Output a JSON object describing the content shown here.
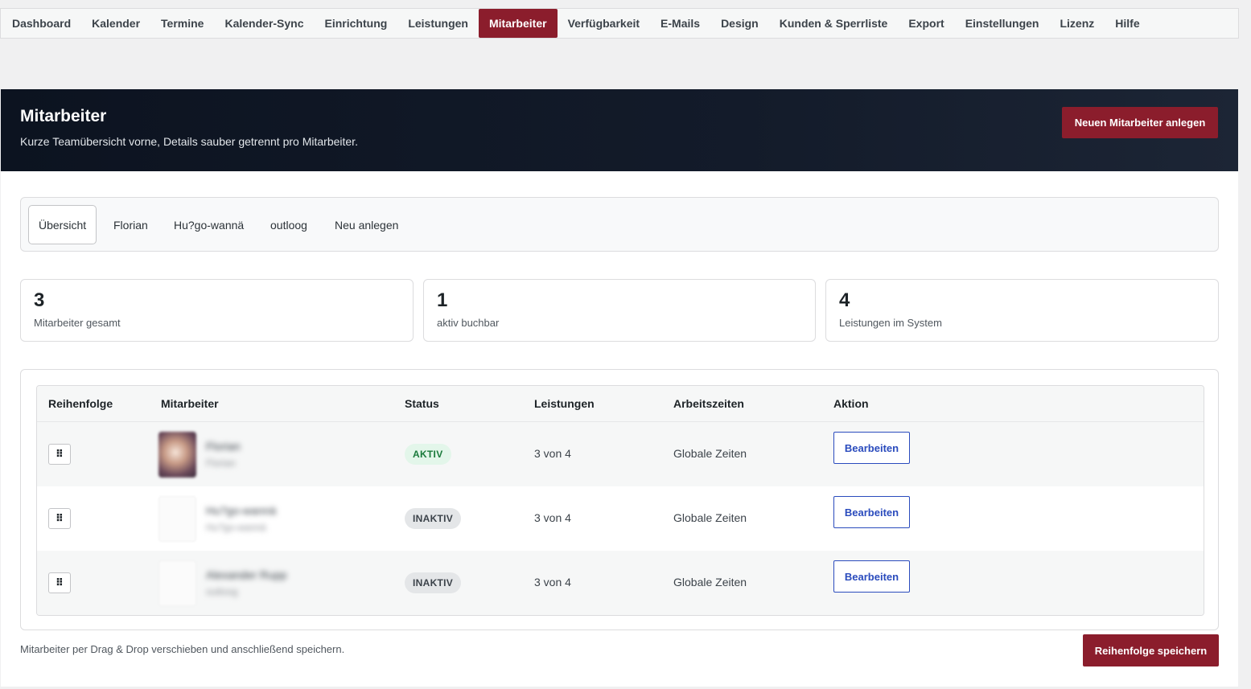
{
  "nav": {
    "items": [
      "Dashboard",
      "Kalender",
      "Termine",
      "Kalender-Sync",
      "Einrichtung",
      "Leistungen",
      "Mitarbeiter",
      "Verfügbarkeit",
      "E-Mails",
      "Design",
      "Kunden & Sperrliste",
      "Export",
      "Einstellungen",
      "Lizenz",
      "Hilfe"
    ],
    "active": "Mitarbeiter"
  },
  "header": {
    "title": "Mitarbeiter",
    "subtitle": "Kurze Teamübersicht vorne, Details sauber getrennt pro Mitarbeiter.",
    "new_button": "Neuen Mitarbeiter anlegen"
  },
  "subtabs": {
    "items": [
      "Übersicht",
      "Florian",
      "Hu?go-wannä",
      "outloog",
      "Neu anlegen"
    ],
    "active": "Übersicht"
  },
  "stats": [
    {
      "value": "3",
      "label": "Mitarbeiter gesamt"
    },
    {
      "value": "1",
      "label": "aktiv buchbar"
    },
    {
      "value": "4",
      "label": "Leistungen im System"
    }
  ],
  "table": {
    "columns": [
      "Reihenfolge",
      "Mitarbeiter",
      "Status",
      "Leistungen",
      "Arbeitszeiten",
      "Aktion"
    ],
    "rows": [
      {
        "handle": "⠿",
        "name": "Florian",
        "sub": "Florian",
        "avatar": "photo",
        "status": "AKTIV",
        "status_type": "active",
        "services": "3 von 4",
        "hours": "Globale Zeiten",
        "action": "Bearbeiten"
      },
      {
        "handle": "⠿",
        "name": "Hu?go-wannä",
        "sub": "Hu?go-wannä",
        "avatar": "blank",
        "status": "INAKTIV",
        "status_type": "inactive",
        "services": "3 von 4",
        "hours": "Globale Zeiten",
        "action": "Bearbeiten"
      },
      {
        "handle": "⠿",
        "name": "Alexander Rupp",
        "sub": "outloog",
        "avatar": "blank",
        "status": "INAKTIV",
        "status_type": "inactive",
        "services": "3 von 4",
        "hours": "Globale Zeiten",
        "action": "Bearbeiten"
      }
    ]
  },
  "footer": {
    "note": "Mitarbeiter per Drag & Drop verschieben und anschließend speichern.",
    "save_button": "Reihenfolge speichern"
  },
  "colors": {
    "accent": "#8b1d2c",
    "hero_bg": "#0c1320",
    "link_blue": "#2a4bbd",
    "active_green": "#1a7a3b"
  }
}
